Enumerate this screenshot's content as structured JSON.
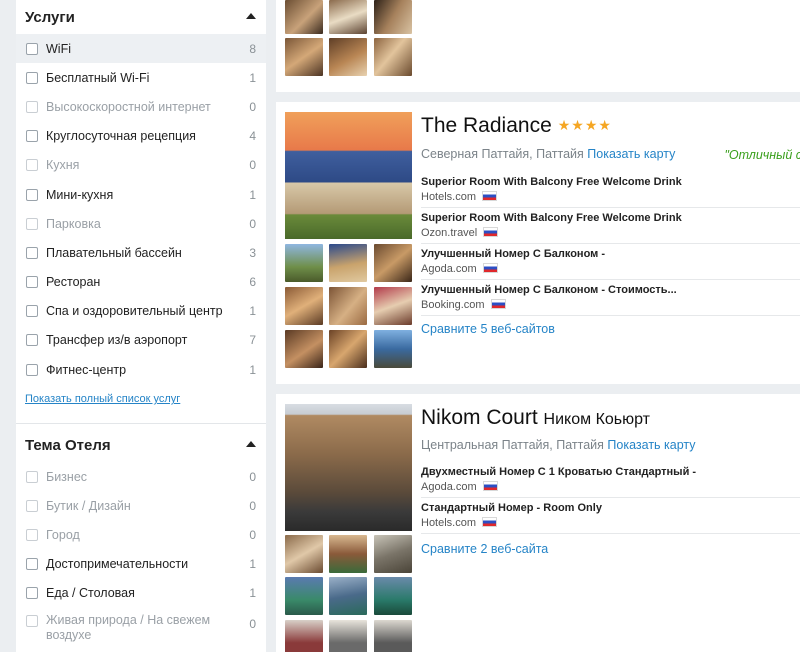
{
  "filters": {
    "services": {
      "title": "Услуги",
      "items": [
        {
          "label": "WiFi",
          "count": "8",
          "disabled": false
        },
        {
          "label": "Бесплатный Wi-Fi",
          "count": "1",
          "disabled": false
        },
        {
          "label": "Высокоскоростной интернет",
          "count": "0",
          "disabled": true
        },
        {
          "label": "Круглосуточная рецепция",
          "count": "4",
          "disabled": false
        },
        {
          "label": "Кухня",
          "count": "0",
          "disabled": true
        },
        {
          "label": "Мини-кухня",
          "count": "1",
          "disabled": false
        },
        {
          "label": "Парковка",
          "count": "0",
          "disabled": true
        },
        {
          "label": "Плавательный бассейн",
          "count": "3",
          "disabled": false
        },
        {
          "label": "Ресторан",
          "count": "6",
          "disabled": false
        },
        {
          "label": "Спа и оздоровительный центр",
          "count": "1",
          "disabled": false
        },
        {
          "label": "Трансфер из/в аэропорт",
          "count": "7",
          "disabled": false
        },
        {
          "label": "Фитнес-центр",
          "count": "1",
          "disabled": false
        }
      ],
      "show_all": "Показать полный список услуг"
    },
    "theme": {
      "title": "Тема Отеля",
      "items": [
        {
          "label": "Бизнес",
          "count": "0",
          "disabled": true
        },
        {
          "label": "Бутик / Дизайн",
          "count": "0",
          "disabled": true
        },
        {
          "label": "Город",
          "count": "0",
          "disabled": true
        },
        {
          "label": "Достопримечательности",
          "count": "1",
          "disabled": false
        },
        {
          "label": "Еда / Столовая",
          "count": "1",
          "disabled": false
        },
        {
          "label": "Живая природа / На свежем воздухе",
          "count": "0",
          "disabled": true
        }
      ]
    }
  },
  "hotels": [
    {
      "name": "The Radiance",
      "stars": "★★★★",
      "location": "Северная Паттайя, Паттайя",
      "map_link": "Показать карту",
      "rating": "\"Отличный с",
      "offers": [
        {
          "title": "Superior Room With Balcony Free Welcome Drink",
          "site": "Hotels.com"
        },
        {
          "title": "Superior Room With Balcony Free Welcome Drink",
          "site": "Ozon.travel"
        },
        {
          "title": "Улучшенный Номер С Балконом -",
          "site": "Agoda.com"
        },
        {
          "title": "Улучшенный Номер С Балконом - Стоимость...",
          "site": "Booking.com"
        }
      ],
      "compare": "Сравните 5 веб-сайтов"
    },
    {
      "name": "Nikom Court",
      "name_sub": "Ником Коьюрт",
      "location": "Центральная Паттайя, Паттайя",
      "map_link": "Показать карту",
      "offers": [
        {
          "title": "Двухместный Номер С 1 Кроватью Стандартный -",
          "site": "Agoda.com"
        },
        {
          "title": "Стандартный Номер - Room Only",
          "site": "Hotels.com"
        }
      ],
      "compare": "Сравните 2 веб-сайта"
    }
  ]
}
